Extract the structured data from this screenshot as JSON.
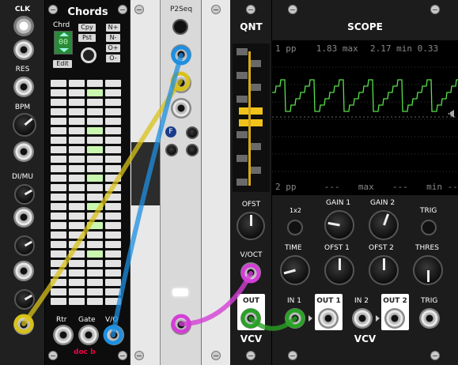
{
  "rack": {
    "clock_module": {
      "labels": [
        "CLK",
        "RES",
        "BPM",
        "DI/MU"
      ]
    },
    "chords_module": {
      "title": "Chords",
      "chord_label": "Chrd",
      "chord_value": "00",
      "buttons": [
        "Cpy",
        "N+",
        "Pst",
        "N-",
        "O+",
        "O-"
      ],
      "edit_label": "Edit",
      "footer_labels": [
        "Rtr",
        "Gate",
        "V/O"
      ],
      "brand": "doc b"
    },
    "p2seq_module": {
      "title": "P2Seq",
      "f_label": "F"
    },
    "quantizer": {
      "title": "QNT",
      "v_oct_label": "V/OCT",
      "out_label": "OUT",
      "brand": "VCV"
    },
    "scope": {
      "title": "SCOPE",
      "top_readout": {
        "channel": "1",
        "pp_label": "pp",
        "pp": "1.83",
        "max_label": "max",
        "max": "2.17",
        "min_label": "min",
        "min": "0.33"
      },
      "bottom_readout": {
        "channel": "2",
        "pp_label": "pp",
        "pp": "---",
        "max_label": "max",
        "max": "---",
        "min_label": "min",
        "min": "---"
      },
      "knob_labels": [
        "OFST",
        "1x2",
        "GAIN 1",
        "GAIN 2",
        "TRIG",
        "TIME",
        "OFST 1",
        "OFST 2",
        "THRES"
      ],
      "jack_labels": [
        "IN 1",
        "OUT 1",
        "IN 2",
        "OUT 2",
        "TRIG"
      ],
      "brand": "VCV",
      "trace_color": "#58e04a",
      "cursor_label": "1"
    },
    "cable_colors": {
      "yellow": "#d8c21a",
      "blue": "#1e8fe0",
      "magenta": "#d33fd6",
      "green": "#2aa126"
    }
  }
}
